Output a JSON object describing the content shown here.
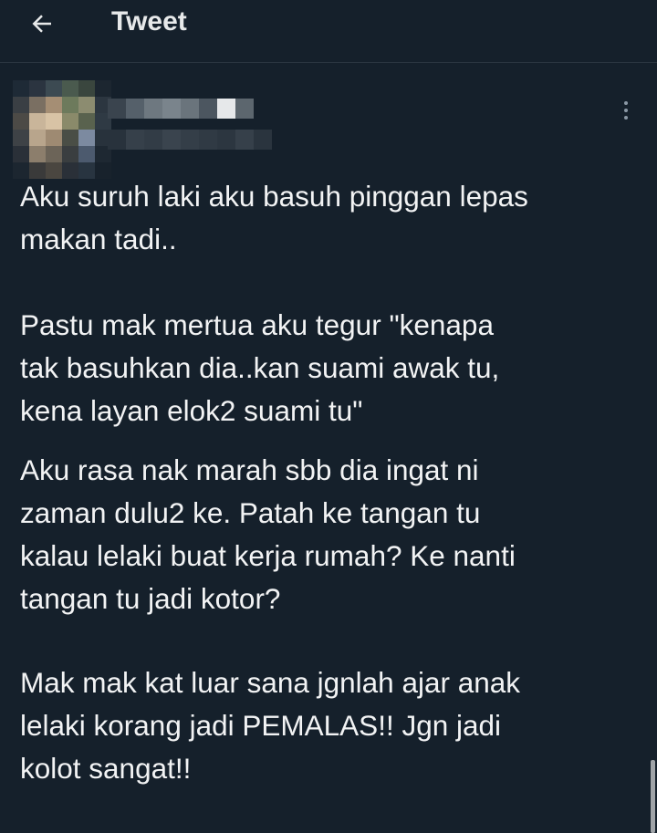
{
  "header": {
    "title": "Tweet",
    "back_icon": "arrow-left-icon"
  },
  "tweet": {
    "author_avatar": "blurred-avatar",
    "author_name": "",
    "author_handle": "",
    "more_icon": "more-vertical-icon",
    "paragraphs": [
      "Aku suruh laki aku basuh pinggan lepas\nmakan tadi..",
      "Pastu mak mertua aku tegur \"kenapa\ntak basuhkan dia..kan suami awak tu,\nkena layan elok2 suami tu\"",
      "Aku rasa nak marah sbb dia ingat ni\nzaman dulu2 ke. Patah ke tangan tu\nkalau lelaki buat kerja rumah? Ke nanti\ntangan tu jadi kotor?",
      "Mak mak kat luar sana jgnlah ajar anak\nlelaki korang jadi PEMALAS!! Jgn jadi\nkolot sangat!!"
    ]
  },
  "colors": {
    "background": "#15202b",
    "text": "#e7e9ea",
    "secondary": "#8b98a5",
    "divider": "#2a3540"
  }
}
